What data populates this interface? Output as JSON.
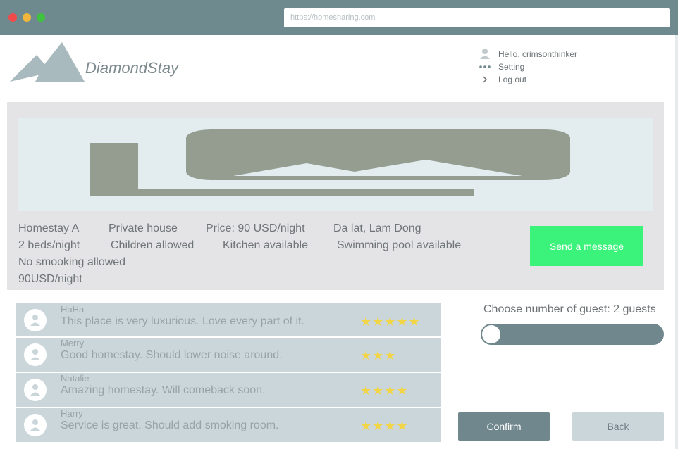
{
  "browser": {
    "url": "https://homesharing.com",
    "window_buttons": [
      "close",
      "minimize",
      "maximize"
    ]
  },
  "header": {
    "brand": "DiamondStay",
    "logo_icon": "mountain-logo",
    "user_menu": {
      "greeting": "Hello, crimsonthinker",
      "setting": "Setting",
      "logout": "Log out"
    }
  },
  "listing": {
    "banner_icon": "image-placeholder",
    "info": [
      "Homestay A",
      "Private house",
      "Price: 90 USD/night",
      "Da lat, Lam Dong",
      "2 beds/night",
      "Children allowed",
      "Kitchen available",
      "Swimming pool available",
      "No smooking allowed",
      "90USD/night"
    ],
    "send_message_label": "Send a message"
  },
  "reviews": [
    {
      "name": "HaHa",
      "text": "This place is very luxurious. Love every part of it.",
      "rating": 5,
      "stars": "★★★★★"
    },
    {
      "name": "Merry",
      "text": "Good homestay. Should lower noise around.",
      "rating": 3,
      "stars": "★★★"
    },
    {
      "name": "Natalie",
      "text": "Amazing homestay. Will comeback soon.",
      "rating": 4,
      "stars": "★★★★"
    },
    {
      "name": "Harry",
      "text": "Service is great. Should add smoking room.",
      "rating": 4,
      "stars": "★★★★"
    }
  ],
  "booking": {
    "guest_label": "Choose number of guest: 2 guests",
    "guest_count": 2,
    "slider_position_fraction": 0.0,
    "confirm_label": "Confirm",
    "back_label": "Back"
  },
  "colors": {
    "titlebar": "#6f8a8f",
    "accent_green": "#3bf27a",
    "primary": "#6f878d",
    "secondary": "#cbd6da",
    "star": "#f1d547",
    "panel": "#e4e4e6"
  }
}
